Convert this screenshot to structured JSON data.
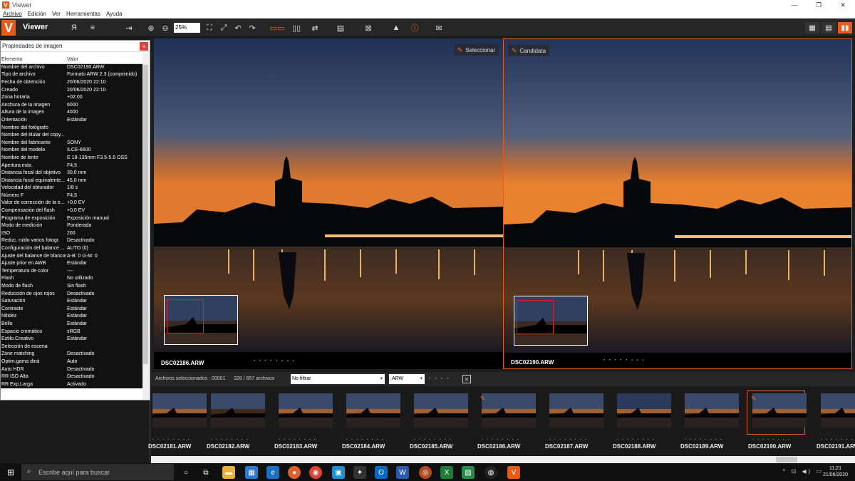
{
  "window": {
    "title": "Viewer",
    "logo_letter": "V",
    "min": "—",
    "max": "❐",
    "close": "✕"
  },
  "menu": [
    "Archivo",
    "Edición",
    "Ver",
    "Herramientas",
    "Ayuda"
  ],
  "toolbar": {
    "app_name": "Viewer",
    "zoom": "25%"
  },
  "props": {
    "title": "Propiedades de imagen",
    "col_element": "Elemento",
    "col_value": "Valor",
    "rows": [
      [
        "Nombre del archivo",
        "DSC02190.ARW"
      ],
      [
        "Tipo de archivo",
        "Formato ARW 2.3 (comprimido)"
      ],
      [
        "Fecha de obtención",
        "20/06/2020 22:10"
      ],
      [
        "Creado",
        "20/06/2020 22:10"
      ],
      [
        "Zona horaria",
        "+02:00"
      ],
      [
        "Anchura de la imagen",
        "6000"
      ],
      [
        "Altura de la imagen",
        "4000"
      ],
      [
        "Orientación",
        "Estándar"
      ],
      [
        "Nombre del fotógrafo",
        ""
      ],
      [
        "Nombre del titular del copy...",
        ""
      ],
      [
        "Nombre del fabricante",
        "SONY"
      ],
      [
        "Nombre del modelo",
        "ILCE-6600"
      ],
      [
        "Nombre de lente",
        "E 18-135mm F3.5-5.6 OSS"
      ],
      [
        "Apertura máx.",
        "F4,5"
      ],
      [
        "Distancia focal del objetivo",
        "30,0 mm"
      ],
      [
        "Distancia focal equivalente...",
        "45,0 mm"
      ],
      [
        "Velocidad del obturador",
        "1/8 s"
      ],
      [
        "Número F",
        "F4,5"
      ],
      [
        "Valor de corrección de la e...",
        "+0,0 EV"
      ],
      [
        "Compensación del flash",
        "+0,0 EV"
      ],
      [
        "Programa de exposición",
        "Exposición manual"
      ],
      [
        "Modo de medición",
        "Ponderada"
      ],
      [
        "ISO",
        "200"
      ],
      [
        "Reduc. ruido varios fotogr.",
        "Desactivado"
      ],
      [
        "Configuración del balance ...",
        "AUTO (0)"
      ],
      [
        "Ajuste del balance de blancos",
        "A-B: 0 G-M: 0"
      ],
      [
        "Ajuste prior en AWB",
        "Estándar"
      ],
      [
        "Temperatura de color",
        "----"
      ],
      [
        "Flash",
        "No utilizado"
      ],
      [
        "Modo de flash",
        "Sin flash"
      ],
      [
        "Reducción de ojos rojos",
        "Desactivado"
      ],
      [
        "Saturación",
        "Estándar"
      ],
      [
        "Contraste",
        "Estándar"
      ],
      [
        "Nitidez",
        "Estándar"
      ],
      [
        "Brillo",
        "Estándar"
      ],
      [
        "Espacio cromático",
        "sRGB"
      ],
      [
        "Estilo.Creativo",
        "Estándar"
      ],
      [
        "Selección de escena",
        ""
      ],
      [
        "Zone matching",
        "Desactivado"
      ],
      [
        "Optim.gama diná",
        "Auto"
      ],
      [
        "Auto HDR",
        "Desactivado"
      ],
      [
        "RR ISO Alta",
        "Desactivado"
      ],
      [
        "RR Exp.Larga",
        "Activado"
      ]
    ]
  },
  "panes": [
    {
      "tag": "Seleccionar",
      "file": "DSC02186.ARW"
    },
    {
      "tag": "Candidata",
      "file": "DSC02190.ARW"
    }
  ],
  "status": {
    "selected": "Archivos seleccionados : 00001",
    "count": "328 / 657 archivos",
    "filter": "No filtrar",
    "ext": ".ARW",
    "clear": "✕"
  },
  "thumbs": [
    {
      "label": "DSC02181.ARW"
    },
    {
      "label": "DSC02182.ARW"
    },
    {
      "label": "DSC02183.ARW"
    },
    {
      "label": "DSC02184.ARW"
    },
    {
      "label": "DSC02185.ARW"
    },
    {
      "label": "DSC02186.ARW"
    },
    {
      "label": "DSC02187.ARW"
    },
    {
      "label": "DSC02188.ARW"
    },
    {
      "label": "DSC02189.ARW"
    },
    {
      "label": "DSC02190.ARW"
    },
    {
      "label": "DSC02191.ARW"
    }
  ],
  "taskbar": {
    "search_placeholder": "Escribe aquí para buscar",
    "time": "11:21",
    "date": "21/06/2020"
  },
  "colors": {
    "accent": "#e85a1a"
  }
}
